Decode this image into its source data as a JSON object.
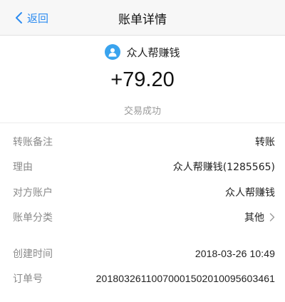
{
  "navbar": {
    "back_label": "返回",
    "title": "账单详情"
  },
  "hero": {
    "payee_name": "众人帮赚钱",
    "amount": "+79.20",
    "status": "交易成功"
  },
  "details": [
    {
      "label": "转账备注",
      "value": "转账"
    },
    {
      "label": "理由",
      "value": "众人帮赚钱(1285565)"
    },
    {
      "label": "对方账户",
      "value": "众人帮赚钱"
    },
    {
      "label": "账单分类",
      "value": "其他"
    }
  ],
  "meta": [
    {
      "label": "创建时间",
      "value": "2018-03-26 10:49"
    },
    {
      "label": "订单号",
      "value": "20180326110070001502010095603461"
    }
  ],
  "colors": {
    "accent": "#2d8cf0",
    "avatar": "#39a3ee"
  }
}
